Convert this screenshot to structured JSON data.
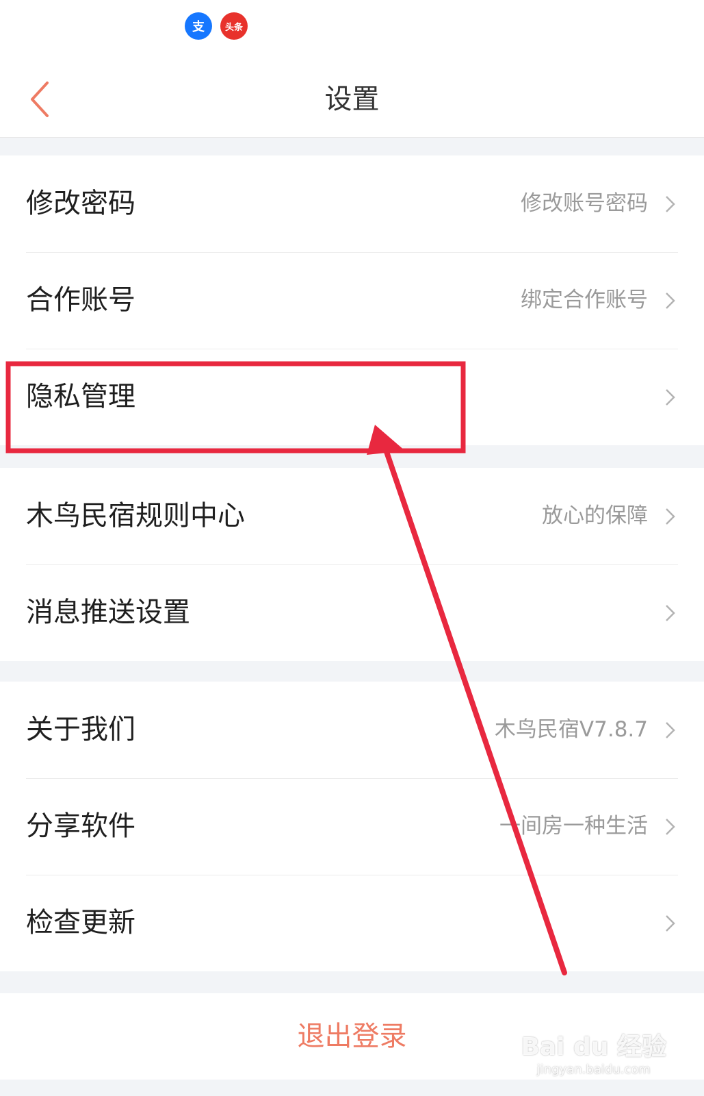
{
  "status_bar": {
    "app_icons": [
      {
        "name": "alipay-icon",
        "glyph": "支"
      },
      {
        "name": "toutiao-icon",
        "glyph": "头条"
      }
    ]
  },
  "header": {
    "title": "设置",
    "back_icon": "chevron-left-icon",
    "back_color": "#ee7b63"
  },
  "groups": [
    {
      "items": [
        {
          "label": "修改密码",
          "value": "修改账号密码"
        },
        {
          "label": "合作账号",
          "value": "绑定合作账号"
        },
        {
          "label": "隐私管理",
          "value": ""
        }
      ]
    },
    {
      "items": [
        {
          "label": "木鸟民宿规则中心",
          "value": "放心的保障"
        },
        {
          "label": "消息推送设置",
          "value": ""
        }
      ]
    },
    {
      "items": [
        {
          "label": "关于我们",
          "value": "木鸟民宿V7.8.7"
        },
        {
          "label": "分享软件",
          "value": "一间房一种生活"
        },
        {
          "label": "检查更新",
          "value": ""
        }
      ]
    }
  ],
  "logout_label": "退出登录",
  "annotation": {
    "color": "#e8283f",
    "highlight_target": "隐私管理"
  },
  "watermark": {
    "logo": "Bai du 经验",
    "url": "jingyan.baidu.com"
  }
}
